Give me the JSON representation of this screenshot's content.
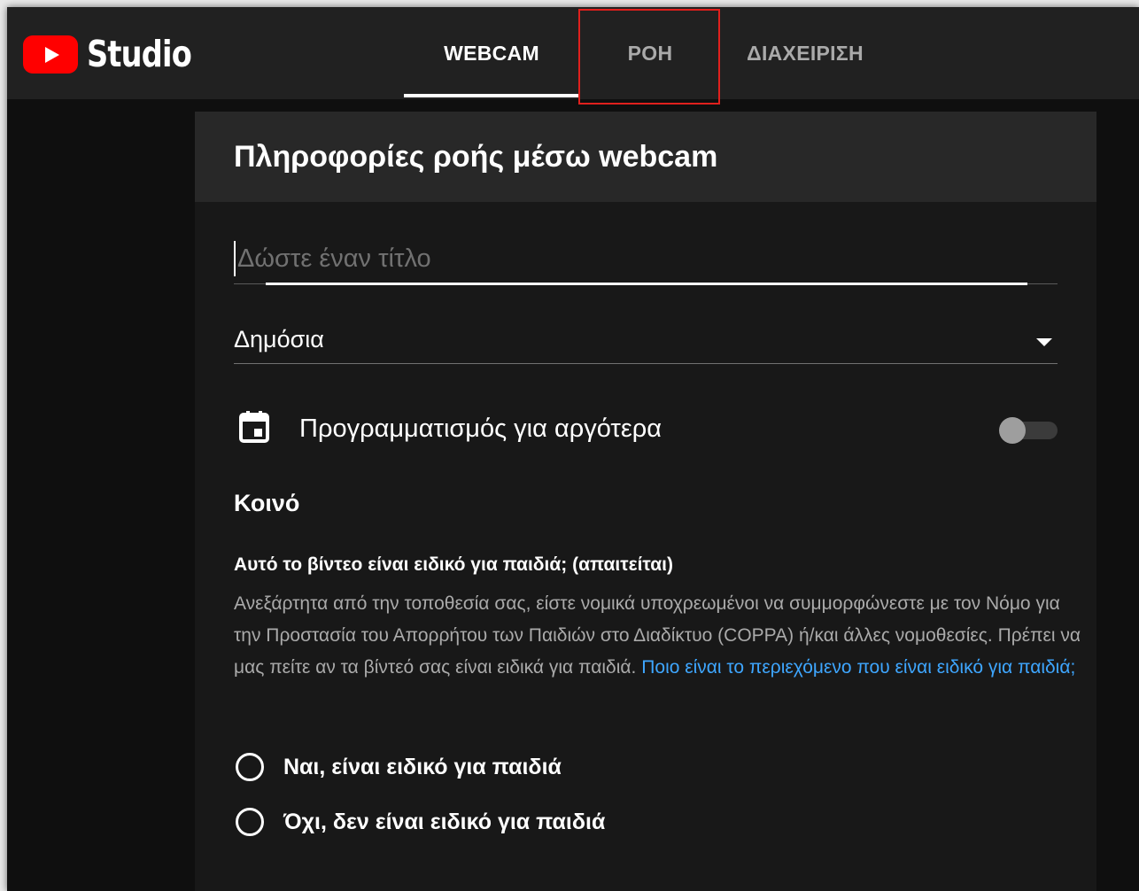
{
  "app": {
    "logo_text": "Studio",
    "logo_icon": "youtube-play-icon",
    "brand_color": "#ff0000"
  },
  "tabs": [
    {
      "label": "WEBCAM",
      "active": true
    },
    {
      "label": "ΡΟΗ",
      "active": false
    },
    {
      "label": "ΔΙΑΧΕΙΡΙΣΗ",
      "active": false
    }
  ],
  "card": {
    "title": "Πληροφορίες ροής μέσω webcam"
  },
  "title_input": {
    "placeholder": "Δώστε έναν τίτλο",
    "value": ""
  },
  "privacy": {
    "selected": "Δημόσια"
  },
  "schedule": {
    "label": "Προγραμματισμός για αργότερα",
    "icon": "calendar-icon",
    "enabled": false
  },
  "audience": {
    "heading": "Κοινό",
    "question": "Αυτό το βίντεο είναι ειδικό για παιδιά; (απαιτείται)",
    "description": "Ανεξάρτητα από την τοποθεσία σας, είστε νομικά υποχρεωμένοι να συμμορφώνεστε με τον Νόμο για την Προστασία του Απορρήτου των Παιδιών στο Διαδίκτυο (COPPA) ή/και άλλες νομοθεσίες. Πρέπει να μας πείτε αν τα βίντεό σας είναι ειδικά για παιδιά.",
    "link": "Ποιο είναι το περιεχόμενο που είναι ειδικό για παιδιά;",
    "link_color": "#3ea6ff",
    "options": [
      {
        "label": "Ναι, είναι ειδικό για παιδιά",
        "selected": false
      },
      {
        "label": "Όχι, δεν είναι ειδικό για παιδιά",
        "selected": false
      }
    ]
  },
  "annotation": {
    "highlight_color": "#e0201d"
  }
}
